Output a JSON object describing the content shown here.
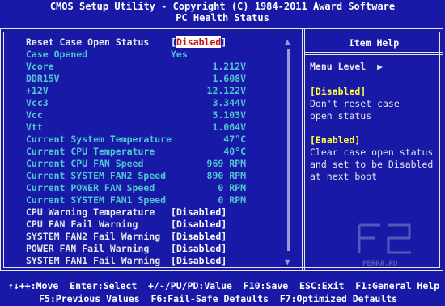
{
  "header": {
    "line1": "CMOS Setup Utility - Copyright (C) 1984-2011 Award Software",
    "line2": "PC Health Status"
  },
  "rows": [
    {
      "label": "Reset Case Open Status",
      "value": "Disabled",
      "state": "selected"
    },
    {
      "label": "Case Opened",
      "value": "Yes",
      "state": "readonly"
    },
    {
      "label": "Vcore",
      "value": "1.212V",
      "state": "readonly"
    },
    {
      "label": "DDR15V",
      "value": "1.608V",
      "state": "readonly"
    },
    {
      "label": "+12V",
      "value": "12.122V",
      "state": "readonly"
    },
    {
      "label": "Vcc3",
      "value": "3.344V",
      "state": "readonly"
    },
    {
      "label": "Vcc",
      "value": "5.103V",
      "state": "readonly"
    },
    {
      "label": "Vtt",
      "value": "1.064V",
      "state": "readonly"
    },
    {
      "label": "Current System Temperature",
      "value": "47°C",
      "state": "readonly"
    },
    {
      "label": "Current CPU Temperature",
      "value": "40°C",
      "state": "readonly"
    },
    {
      "label": "Current CPU FAN Speed",
      "value": "969 RPM",
      "state": "readonly"
    },
    {
      "label": "Current SYSTEM FAN2 Speed",
      "value": "890 RPM",
      "state": "readonly"
    },
    {
      "label": "Current POWER FAN Speed",
      "value": "0 RPM",
      "state": "readonly"
    },
    {
      "label": "Current SYSTEM FAN1 Speed",
      "value": "0 RPM",
      "state": "readonly"
    },
    {
      "label": "CPU Warning Temperature",
      "value": "Disabled",
      "state": "active"
    },
    {
      "label": "CPU FAN Fail Warning",
      "value": "Disabled",
      "state": "active"
    },
    {
      "label": "SYSTEM FAN2 Fail Warning",
      "value": "Disabled",
      "state": "active"
    },
    {
      "label": "POWER FAN Fail Warning",
      "value": "Disabled",
      "state": "active"
    },
    {
      "label": "SYSTEM FAN1 Fail Warning",
      "value": "Disabled",
      "state": "active"
    }
  ],
  "help": {
    "title": "Item Help",
    "menu_level": "Menu Level",
    "menu_level_arrow": "▶",
    "disabled_head": "[Disabled]",
    "disabled_lines": [
      "Don't reset case",
      "open status"
    ],
    "enabled_head": "[Enabled]",
    "enabled_lines": [
      "Clear case open status",
      "and set to be Disabled",
      "at next boot"
    ]
  },
  "footer": {
    "line1": "↑↓++:Move  Enter:Select  +/-/PU/PD:Value  F10:Save  ESC:Exit  F1:General Help",
    "line2": "F5:Previous Values  F6:Fail-Safe Defaults  F7:Optimized Defaults"
  },
  "watermark": "F2 FERRA.RU",
  "colors": {
    "background": "#1919a8",
    "dim_text": "#4ec7d0",
    "help_highlight": "#ffff40",
    "selected_value": "#cc1010"
  }
}
